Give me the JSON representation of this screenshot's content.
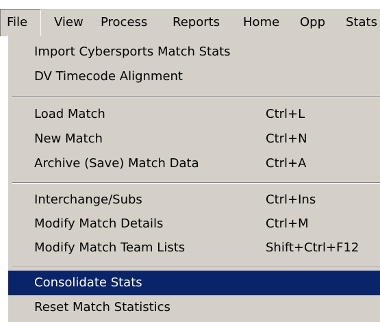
{
  "menubar": {
    "items": [
      {
        "label": "File"
      },
      {
        "label": "View"
      },
      {
        "label": "Process"
      },
      {
        "label": "Reports"
      },
      {
        "label": "Home"
      },
      {
        "label": "Opp"
      },
      {
        "label": "Stats"
      }
    ],
    "open_item": "File"
  },
  "file_menu": {
    "groups": [
      {
        "items": [
          {
            "label": "Import Cybersports Match Stats",
            "shortcut": ""
          },
          {
            "label": "DV Timecode Alignment",
            "shortcut": ""
          }
        ]
      },
      {
        "items": [
          {
            "label": "Load Match",
            "shortcut": "Ctrl+L"
          },
          {
            "label": "New Match",
            "shortcut": "Ctrl+N"
          },
          {
            "label": "Archive (Save) Match Data",
            "shortcut": "Ctrl+A"
          }
        ]
      },
      {
        "items": [
          {
            "label": "Interchange/Subs",
            "shortcut": "Ctrl+Ins"
          },
          {
            "label": "Modify Match Details",
            "shortcut": "Ctrl+M"
          },
          {
            "label": "Modify Match Team Lists",
            "shortcut": "Shift+Ctrl+F12"
          }
        ]
      },
      {
        "items": [
          {
            "label": "Consolidate Stats",
            "shortcut": "",
            "highlighted": true
          },
          {
            "label": "Reset Match Statistics",
            "shortcut": ""
          }
        ]
      }
    ]
  },
  "colors": {
    "menu_background": "#d4d0c8",
    "highlight_background": "#0a246a",
    "highlight_text": "#ffffff",
    "separator_dark": "#808080",
    "separator_light": "#ffffff"
  }
}
